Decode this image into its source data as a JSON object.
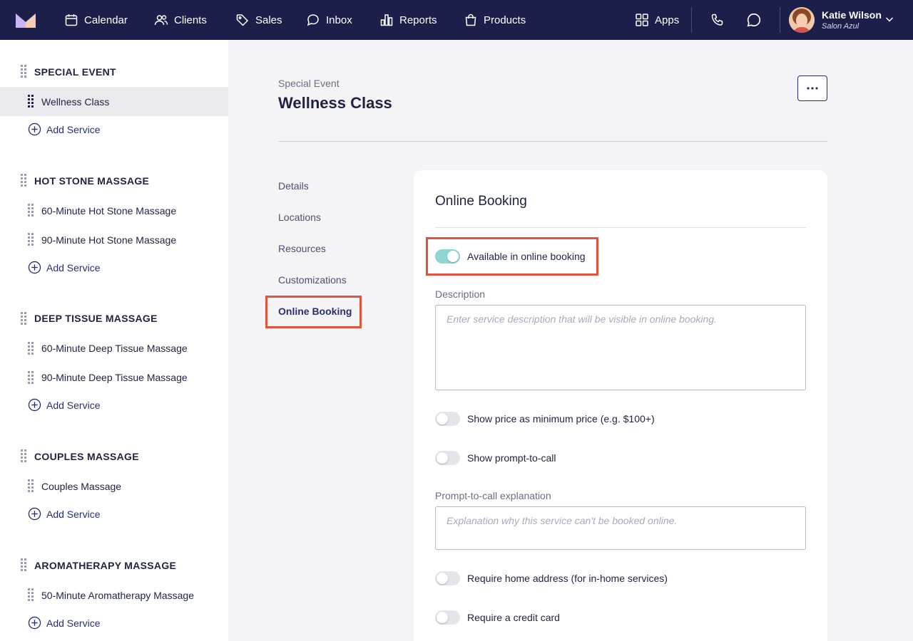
{
  "nav": {
    "items": [
      {
        "label": "Calendar",
        "icon": "calendar-icon"
      },
      {
        "label": "Clients",
        "icon": "users-icon"
      },
      {
        "label": "Sales",
        "icon": "tag-icon"
      },
      {
        "label": "Inbox",
        "icon": "chat-bubble-icon"
      },
      {
        "label": "Reports",
        "icon": "bar-chart-icon"
      },
      {
        "label": "Products",
        "icon": "shopping-bag-icon"
      }
    ],
    "apps_label": "Apps",
    "user_name": "Katie Wilson",
    "user_org": "Salon Azul"
  },
  "sidebar": {
    "add_service_label": "Add Service",
    "categories": [
      {
        "title": "SPECIAL EVENT",
        "services": [
          "Wellness Class"
        ]
      },
      {
        "title": "HOT STONE MASSAGE",
        "services": [
          "60-Minute Hot Stone Massage",
          "90-Minute Hot Stone Massage"
        ]
      },
      {
        "title": "DEEP TISSUE MASSAGE",
        "services": [
          "60-Minute Deep Tissue Massage",
          "90-Minute Deep Tissue Massage"
        ]
      },
      {
        "title": "COUPLES MASSAGE",
        "services": [
          "Couples Massage"
        ]
      },
      {
        "title": "AROMATHERAPY MASSAGE",
        "services": [
          "50-Minute Aromatherapy Massage"
        ]
      }
    ]
  },
  "main": {
    "breadcrumb": "Special Event",
    "title": "Wellness Class",
    "subnav": [
      "Details",
      "Locations",
      "Resources",
      "Customizations",
      "Online Booking"
    ],
    "active_subnav": "Online Booking"
  },
  "card": {
    "title": "Online Booking",
    "toggles": {
      "available": {
        "label": "Available in online booking",
        "on": true
      },
      "min_price": {
        "label": "Show price as minimum price (e.g. $100+)",
        "on": false
      },
      "prompt_call": {
        "label": "Show prompt-to-call",
        "on": false
      },
      "home_address": {
        "label": "Require home address (for in-home services)",
        "on": false
      },
      "credit_card": {
        "label": "Require a credit card",
        "on": false
      }
    },
    "description": {
      "label": "Description",
      "value": "",
      "placeholder": "Enter service description that will be visible in online booking."
    },
    "prompt_explanation": {
      "label": "Prompt-to-call explanation",
      "value": "",
      "placeholder": "Explanation why this service can't be booked online."
    }
  },
  "colors": {
    "nav_bg": "#1d1f4b",
    "accent": "#2a2e6e",
    "highlight": "#e0533c",
    "toggle_on": "#8fd6d3"
  }
}
